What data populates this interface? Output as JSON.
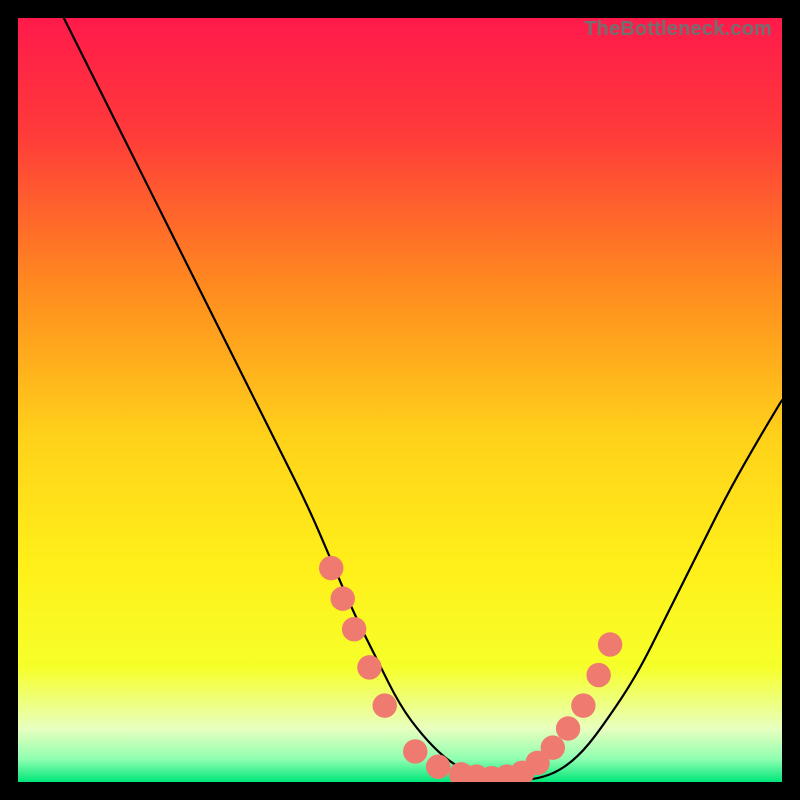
{
  "watermark": "TheBottleneck.com",
  "chart_data": {
    "type": "line",
    "title": "",
    "xlabel": "",
    "ylabel": "",
    "xlim": [
      0,
      100
    ],
    "ylim": [
      0,
      100
    ],
    "gradient_stops": [
      {
        "offset": 0.0,
        "color": "#ff1a4b"
      },
      {
        "offset": 0.15,
        "color": "#ff3a3a"
      },
      {
        "offset": 0.35,
        "color": "#ff8a1f"
      },
      {
        "offset": 0.55,
        "color": "#ffd21a"
      },
      {
        "offset": 0.72,
        "color": "#fff01a"
      },
      {
        "offset": 0.85,
        "color": "#f6ff2a"
      },
      {
        "offset": 0.93,
        "color": "#e8ffbf"
      },
      {
        "offset": 0.97,
        "color": "#8fffb0"
      },
      {
        "offset": 1.0,
        "color": "#00e67a"
      }
    ],
    "series": [
      {
        "name": "curve",
        "stroke": "#000000",
        "x": [
          6,
          8,
          10,
          12,
          15,
          18,
          22,
          26,
          30,
          34,
          38,
          41,
          44,
          47,
          50,
          53,
          56,
          59,
          62,
          65,
          68,
          71,
          74,
          77,
          81,
          85,
          89,
          93,
          97,
          100
        ],
        "y": [
          100,
          96,
          92,
          88,
          82,
          76,
          68,
          60,
          52,
          44,
          36,
          29,
          22,
          16,
          10,
          6,
          3,
          1.2,
          0.4,
          0.2,
          0.4,
          1.5,
          4,
          8,
          14,
          22,
          30,
          38,
          45,
          50
        ]
      }
    ],
    "markers": {
      "name": "dots",
      "color": "#ef7a70",
      "radius": 1.6,
      "x": [
        41,
        42.5,
        44,
        46,
        48,
        52,
        55,
        58,
        60,
        62,
        64,
        66,
        68,
        70,
        72,
        74,
        76,
        77.5
      ],
      "y": [
        28,
        24,
        20,
        15,
        10,
        4,
        2,
        1,
        0.7,
        0.5,
        0.7,
        1.2,
        2.5,
        4.5,
        7,
        10,
        14,
        18
      ]
    }
  }
}
